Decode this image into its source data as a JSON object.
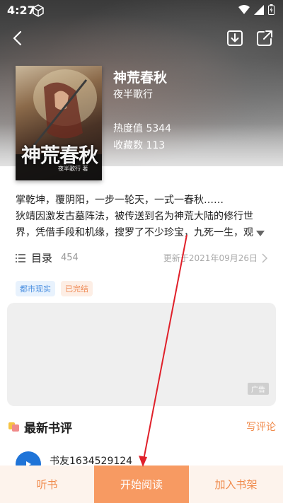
{
  "status_bar": {
    "time": "4:27"
  },
  "book": {
    "title": "神荒春秋",
    "author": "夜半歌行",
    "heat": "热度值 5344",
    "favorites": "收藏数 113",
    "cover_title": "神荒春秋",
    "cover_author": "夜半歌行 著"
  },
  "description": {
    "line1": "掌乾坤，覆阴阳，一步一轮天，一式一春秋……",
    "line2": "狄靖因激发古墓阵法，被传送到名为神荒大陆的修行世",
    "line3": "界，凭借手段和机缘，搜罗了不少珍宝，九死一生，观"
  },
  "catalog": {
    "label": "目录",
    "count": "454",
    "update": "更新于2021年09月26日"
  },
  "tags": [
    "都市现实",
    "已完结"
  ],
  "ad": {
    "label": "广告"
  },
  "reviews": {
    "title": "最新书评",
    "write": "写评论",
    "first_user": "书友1634529124"
  },
  "bottom_bar": {
    "listen": "听书",
    "read": "开始阅读",
    "shelf": "加入书架"
  },
  "colors": {
    "accent": "#f79a62",
    "accent_text": "#f08a4b",
    "annotation": "#e0202a"
  },
  "icons": [
    "back-icon",
    "download-icon",
    "share-icon",
    "catalog-list-icon",
    "chevron-right-icon",
    "expand-arrow-icon",
    "wifi-icon",
    "signal-icon",
    "battery-icon"
  ]
}
